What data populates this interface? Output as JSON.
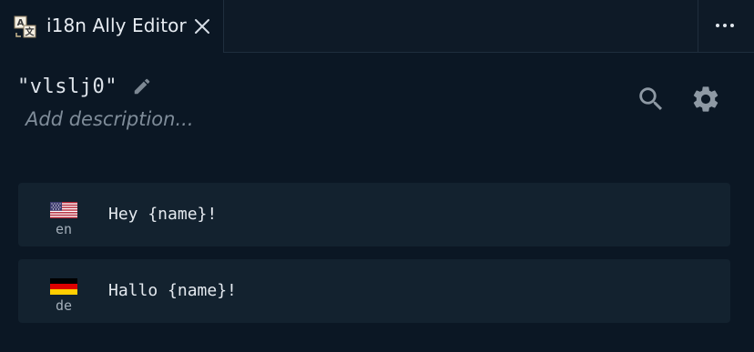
{
  "tab": {
    "title": "i18n Ally Editor",
    "icon": "translate-icon",
    "close_icon": "close-icon"
  },
  "toolbar": {
    "more_icon": "ellipsis-icon"
  },
  "editor": {
    "key": "\"vlslj0\"",
    "description_placeholder": "Add description...",
    "edit_icon": "pencil-icon",
    "search_icon": "search-icon",
    "settings_icon": "gear-icon"
  },
  "translations": [
    {
      "locale": "en",
      "flag": "us-flag",
      "value": "Hey {name}!"
    },
    {
      "locale": "de",
      "flag": "germany-flag",
      "value": "Hallo {name}!"
    }
  ],
  "colors": {
    "background": "#0b1724",
    "card": "#13222f",
    "text": "#e4e9ef",
    "muted": "#7f8c99",
    "icon": "#8e99a4"
  }
}
